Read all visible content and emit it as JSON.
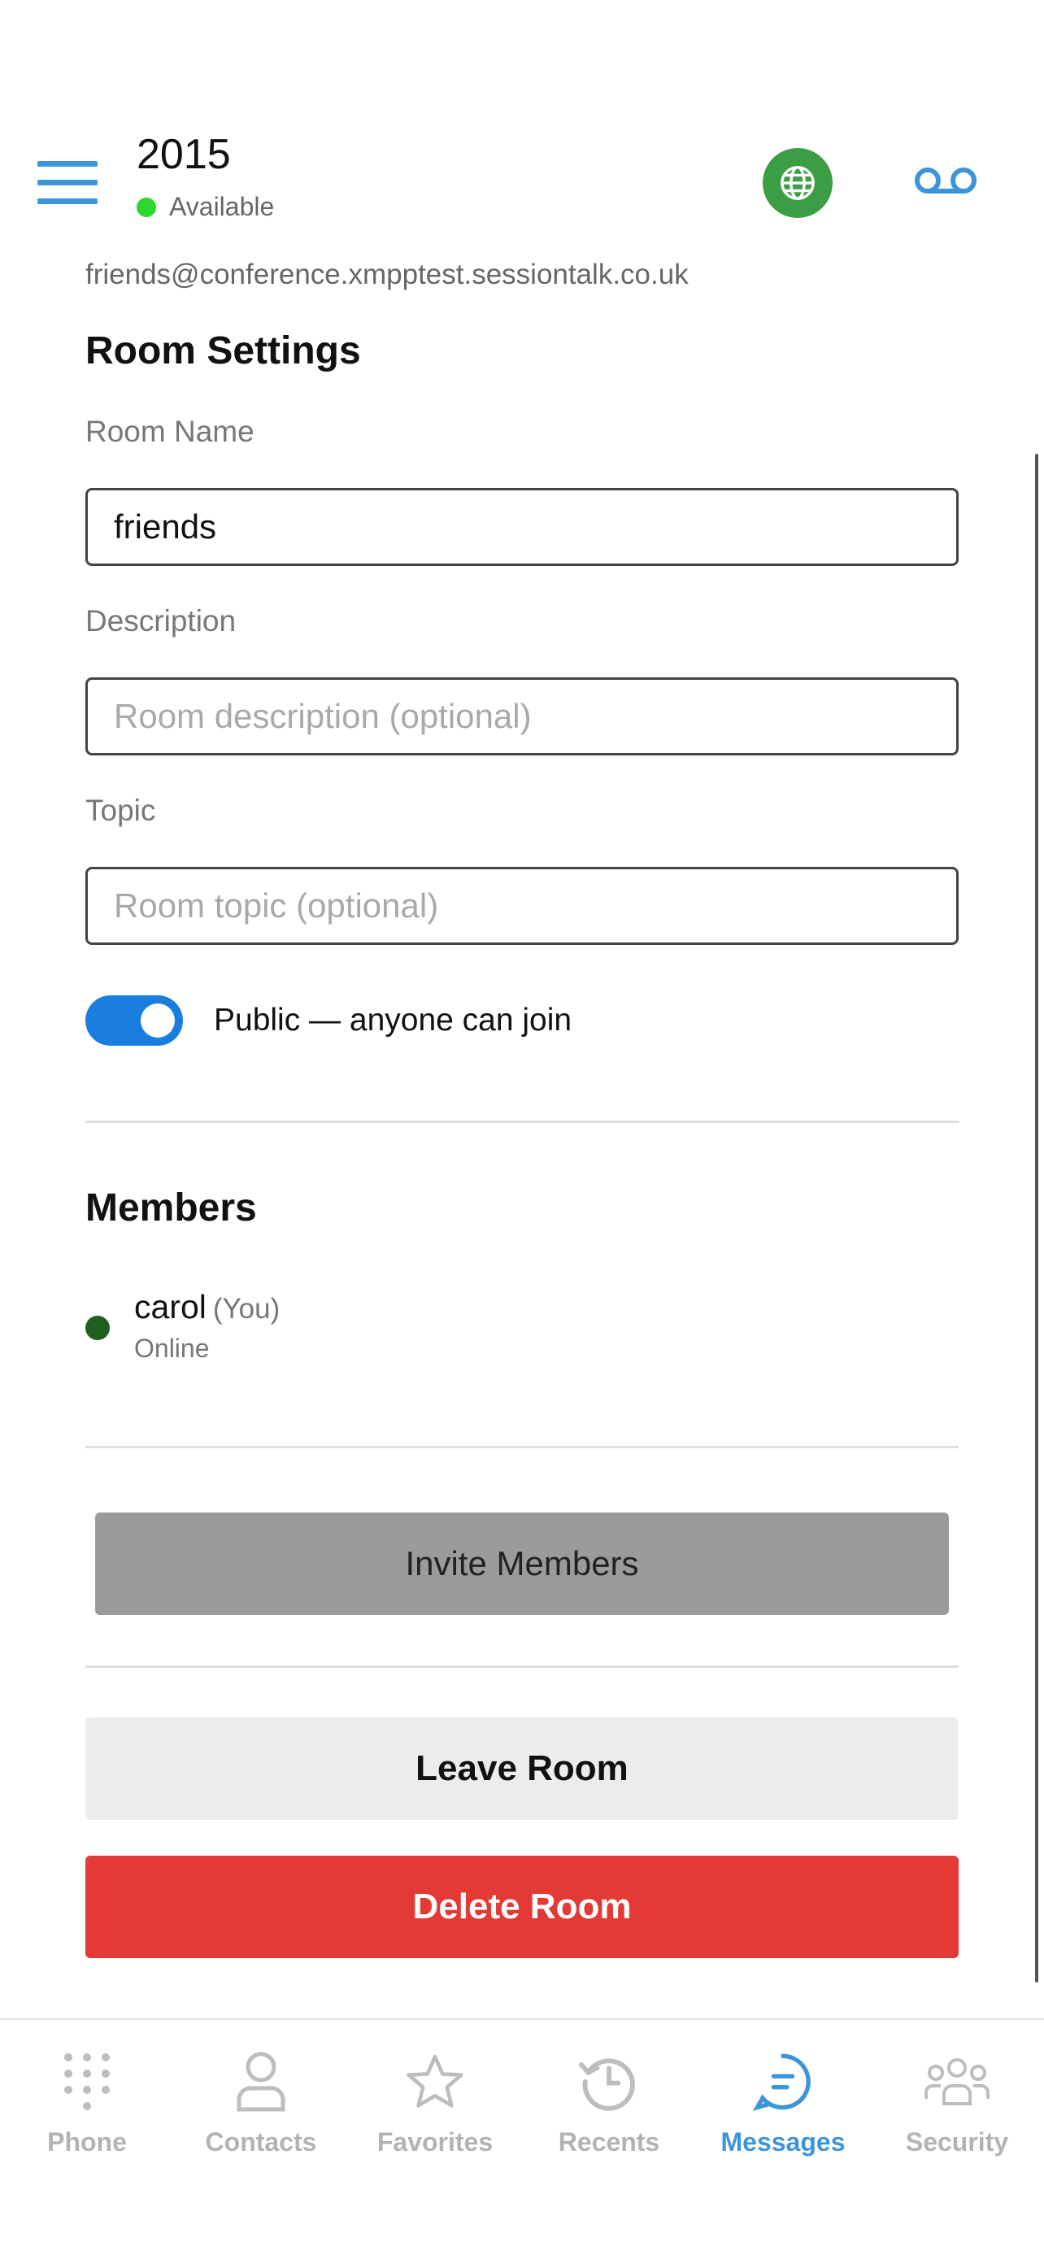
{
  "header": {
    "title": "2015",
    "status": "Available"
  },
  "room": {
    "jid": "friends@conference.xmpptest.sessiontalk.co.uk",
    "settings_title": "Room Settings",
    "name_label": "Room Name",
    "name_value": "friends",
    "description_label": "Description",
    "description_placeholder": "Room description (optional)",
    "topic_label": "Topic",
    "topic_placeholder": "Room topic (optional)",
    "public_label": "Public — anyone can join",
    "public_enabled": true
  },
  "members": {
    "title": "Members",
    "items": [
      {
        "name": "carol",
        "tag": "(You)",
        "status": "Online"
      }
    ]
  },
  "actions": {
    "invite": "Invite Members",
    "leave": "Leave Room",
    "delete": "Delete Room"
  },
  "tabs": [
    {
      "label": "Phone",
      "icon": "dialpad-icon"
    },
    {
      "label": "Contacts",
      "icon": "person-icon"
    },
    {
      "label": "Favorites",
      "icon": "star-icon"
    },
    {
      "label": "Recents",
      "icon": "history-icon"
    },
    {
      "label": "Messages",
      "icon": "chat-icon",
      "active": true
    },
    {
      "label": "Security",
      "icon": "group-icon"
    }
  ],
  "colors": {
    "accent": "#3d95d9",
    "status_green": "#2bd82b",
    "globe_bg": "#3b9e44",
    "toggle_on": "#1a7ee0",
    "delete_red": "#e33a36",
    "invite_gray": "#9b9b9b",
    "tab_inactive": "#b3b3b3"
  }
}
